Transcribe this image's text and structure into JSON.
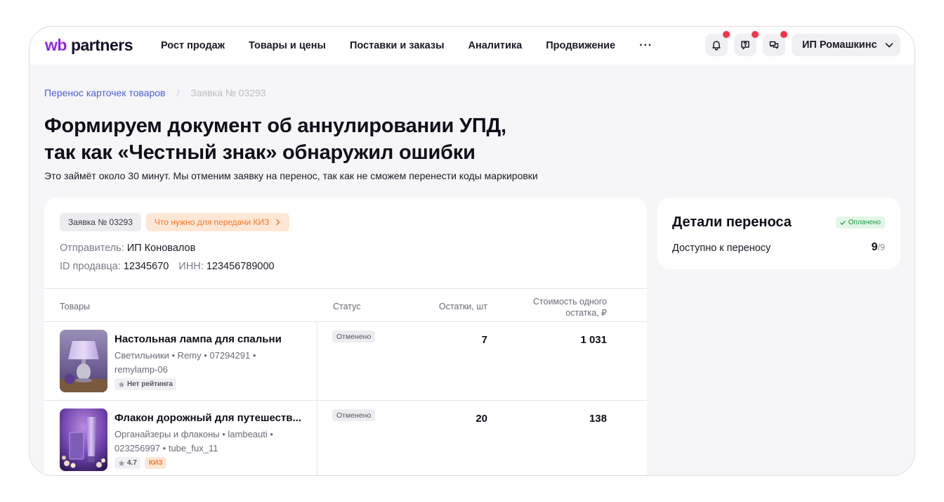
{
  "header": {
    "logo_wb": "wb",
    "logo_partners": "partners",
    "nav": [
      "Рост продаж",
      "Товары и цены",
      "Поставки и заказы",
      "Аналитика",
      "Продвижение"
    ],
    "more": "···",
    "profile_name": "ИП Ромашкинс"
  },
  "breadcrumb": {
    "parent": "Перенос карточек товаров",
    "separator": "/",
    "current": "Заявка № 03293"
  },
  "title": {
    "line1": "Формируем документ об аннулировании УПД,",
    "line2": "так как «Честный знак» обнаружил ошибки"
  },
  "subtitle": "Это займёт около 30 минут. Мы отменим заявку на перенос, так как не сможем перенести коды маркировки",
  "request": {
    "number_tag": "Заявка № 03293",
    "kiz_tag": "Что нужно для передачи КИЗ",
    "sender_label": "Отправитель:",
    "sender_value": "ИП Коновалов",
    "seller_id_label": "ID продавца:",
    "seller_id_value": "12345670",
    "inn_label": "ИНН:",
    "inn_value": "123456789000"
  },
  "table": {
    "headers": {
      "goods": "Товары",
      "status": "Статус",
      "stock": "Остатки, шт",
      "price_line1": "Стоимость одного",
      "price_line2": "остатка, ₽"
    },
    "rows": [
      {
        "title": "Настольная лампа для спальни",
        "meta": "Светильники • Remy • 07294291 • remylamp-06",
        "rating": "Нет рейтинга",
        "kiz": "",
        "status": "Отменено",
        "stock": "7",
        "price": "1 031"
      },
      {
        "title": "Флакон дорожный для путешеств...",
        "meta": "Органайзеры и флаконы • lambeauti • 023256997 • tube_fux_11",
        "rating": "4.7",
        "kiz": "КИЗ",
        "status": "Отменено",
        "stock": "20",
        "price": "138"
      }
    ]
  },
  "details": {
    "title": "Детали переноса",
    "paid_badge": "Оплачено",
    "available_label": "Доступно к переносу",
    "available_value": "9",
    "available_total": "/9"
  },
  "colors": {
    "brand": "#8a2be2",
    "link": "#4d5fd6",
    "notification_dot": "#f5334b",
    "kiz_orange": "#f07b2e",
    "paid_green": "#1b9a45"
  },
  "icons": [
    "bell-icon",
    "support-chat-icon",
    "messages-icon",
    "chevron-down-icon",
    "chevron-right-icon",
    "star-icon",
    "check-icon"
  ]
}
